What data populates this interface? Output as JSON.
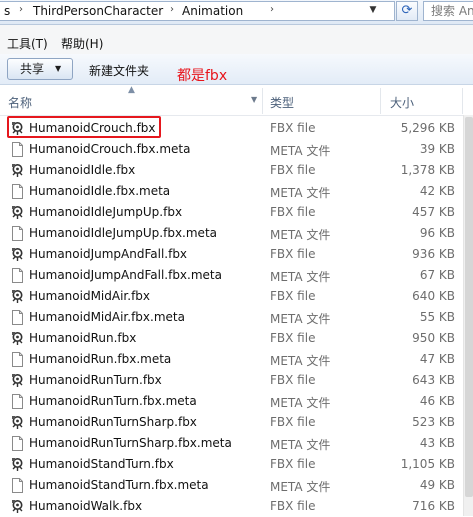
{
  "address": {
    "crumbs": [
      "s",
      "ThirdPersonCharacter",
      "Animation"
    ],
    "search_placeholder": "搜索 Ani",
    "refresh_icon": "refresh-icon"
  },
  "menu": {
    "items": [
      "工具(T)",
      "帮助(H)"
    ]
  },
  "toolbar": {
    "share_label": "共享",
    "new_folder_label": "新建文件夹"
  },
  "annotation": {
    "text": "都是fbx",
    "color": "#e8141b"
  },
  "columns": {
    "name": "名称",
    "type": "类型",
    "size": "大小"
  },
  "files": [
    {
      "name": "HumanoidCrouch.fbx",
      "type": "FBX file",
      "size": "5,296 KB",
      "icon": "fbx-file-icon"
    },
    {
      "name": "HumanoidCrouch.fbx.meta",
      "type": "META 文件",
      "size": "39 KB",
      "icon": "generic-file-icon"
    },
    {
      "name": "HumanoidIdle.fbx",
      "type": "FBX file",
      "size": "1,378 KB",
      "icon": "fbx-file-icon"
    },
    {
      "name": "HumanoidIdle.fbx.meta",
      "type": "META 文件",
      "size": "42 KB",
      "icon": "generic-file-icon"
    },
    {
      "name": "HumanoidIdleJumpUp.fbx",
      "type": "FBX file",
      "size": "457 KB",
      "icon": "fbx-file-icon"
    },
    {
      "name": "HumanoidIdleJumpUp.fbx.meta",
      "type": "META 文件",
      "size": "96 KB",
      "icon": "generic-file-icon"
    },
    {
      "name": "HumanoidJumpAndFall.fbx",
      "type": "FBX file",
      "size": "936 KB",
      "icon": "fbx-file-icon"
    },
    {
      "name": "HumanoidJumpAndFall.fbx.meta",
      "type": "META 文件",
      "size": "67 KB",
      "icon": "generic-file-icon"
    },
    {
      "name": "HumanoidMidAir.fbx",
      "type": "FBX file",
      "size": "640 KB",
      "icon": "fbx-file-icon"
    },
    {
      "name": "HumanoidMidAir.fbx.meta",
      "type": "META 文件",
      "size": "55 KB",
      "icon": "generic-file-icon"
    },
    {
      "name": "HumanoidRun.fbx",
      "type": "FBX file",
      "size": "950 KB",
      "icon": "fbx-file-icon"
    },
    {
      "name": "HumanoidRun.fbx.meta",
      "type": "META 文件",
      "size": "47 KB",
      "icon": "generic-file-icon"
    },
    {
      "name": "HumanoidRunTurn.fbx",
      "type": "FBX file",
      "size": "643 KB",
      "icon": "fbx-file-icon"
    },
    {
      "name": "HumanoidRunTurn.fbx.meta",
      "type": "META 文件",
      "size": "46 KB",
      "icon": "generic-file-icon"
    },
    {
      "name": "HumanoidRunTurnSharp.fbx",
      "type": "FBX file",
      "size": "523 KB",
      "icon": "fbx-file-icon"
    },
    {
      "name": "HumanoidRunTurnSharp.fbx.meta",
      "type": "META 文件",
      "size": "43 KB",
      "icon": "generic-file-icon"
    },
    {
      "name": "HumanoidStandTurn.fbx",
      "type": "FBX file",
      "size": "1,105 KB",
      "icon": "fbx-file-icon"
    },
    {
      "name": "HumanoidStandTurn.fbx.meta",
      "type": "META 文件",
      "size": "49 KB",
      "icon": "generic-file-icon"
    },
    {
      "name": "HumanoidWalk.fbx",
      "type": "FBX file",
      "size": "716 KB",
      "icon": "fbx-file-icon"
    }
  ]
}
